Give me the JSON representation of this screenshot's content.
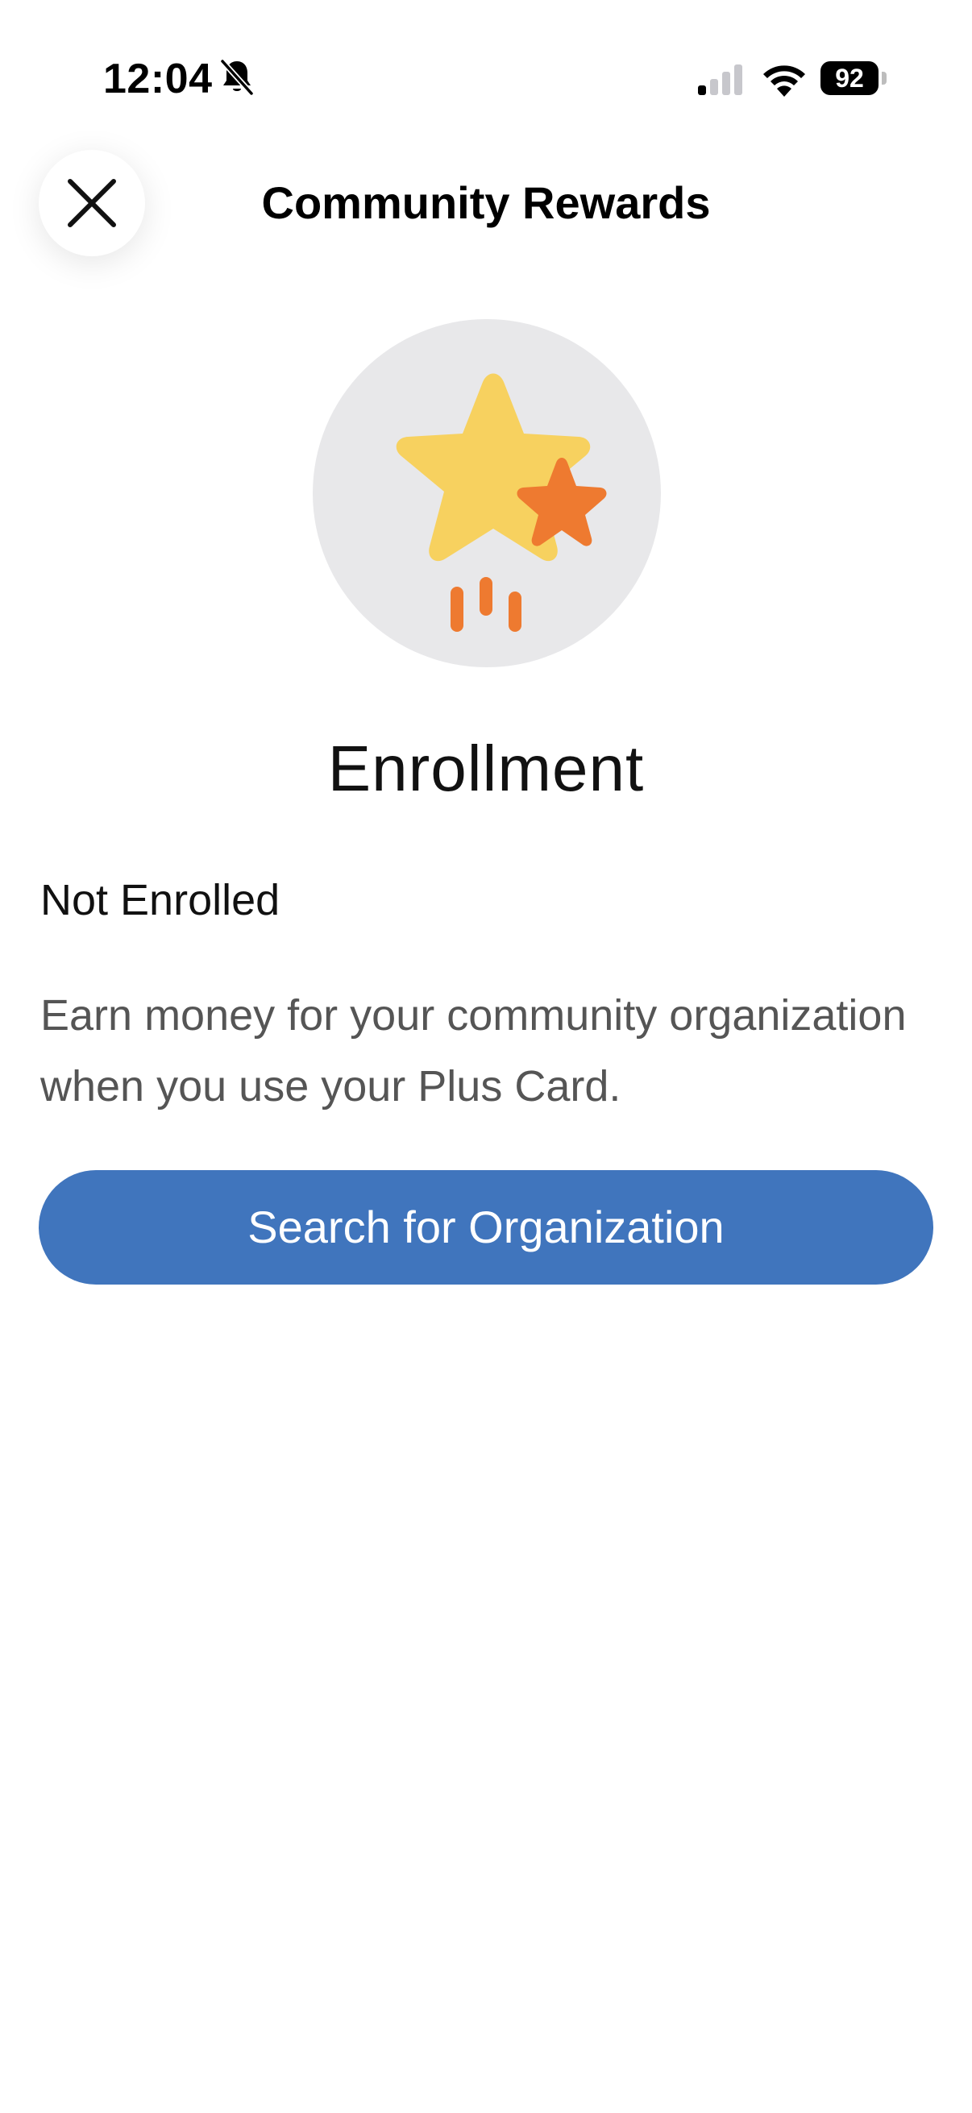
{
  "status_bar": {
    "time": "12:04",
    "battery": "92",
    "icons": [
      "bell-slash-icon",
      "cellular-signal-icon",
      "wifi-icon",
      "battery-icon"
    ]
  },
  "header": {
    "title": "Community Rewards",
    "close_icon": "close-icon"
  },
  "hero": {
    "icon": "stars-icon",
    "colors": {
      "circle": "#e8e8ea",
      "big_star": "#f7d15f",
      "small_star": "#ee7a30"
    }
  },
  "enrollment": {
    "heading": "Enrollment",
    "status": "Not Enrolled",
    "description": "Earn money for your community organization when you use your Plus Card.",
    "button_label": "Search for Organization"
  },
  "colors": {
    "accent": "#4075bd",
    "text_primary": "#111111",
    "text_secondary": "#555555"
  }
}
